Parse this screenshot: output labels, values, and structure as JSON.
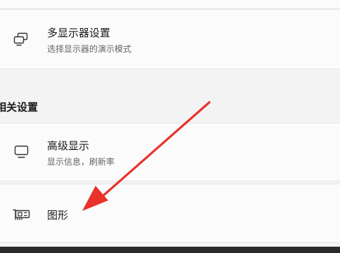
{
  "multi_display": {
    "title": "多显示器设置",
    "subtitle": "选择显示器的演示模式",
    "icon": "multi-monitor-icon"
  },
  "related_section": {
    "heading": "相关设置"
  },
  "advanced_display": {
    "title": "高级显示",
    "subtitle": "显示信息，刷新率",
    "icon": "monitor-icon"
  },
  "graphics": {
    "title": "图形",
    "icon": "gpu-icon"
  },
  "annotation": {
    "color": "#e8322a",
    "icon": "red-arrow-annotation"
  }
}
